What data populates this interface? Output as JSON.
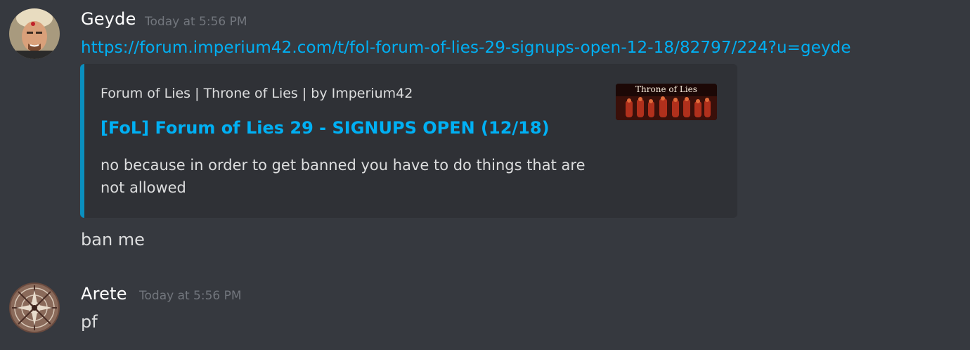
{
  "messages": [
    {
      "username": "Geyde",
      "timestamp": "Today at 5:56 PM",
      "link": "https://forum.imperium42.com/t/fol-forum-of-lies-29-signups-open-12-18/82797/224?u=geyde",
      "embed": {
        "provider": "Forum of Lies | Throne of Lies | by Imperium42",
        "title": "[FoL] Forum of Lies 29 - SIGNUPS OPEN (12/18)",
        "description": "no because in order to get banned you have to do things that are not allowed",
        "thumbnail_text": "Throne of Lies"
      },
      "text": "ban me"
    },
    {
      "username": "Arete",
      "timestamp": "Today at 5:56 PM",
      "text": "pf"
    }
  ],
  "colors": {
    "background": "#36393f",
    "embed_background": "#2f3136",
    "embed_accent": "#0a8fbf",
    "link": "#00b0f4",
    "timestamp": "#72767d"
  }
}
